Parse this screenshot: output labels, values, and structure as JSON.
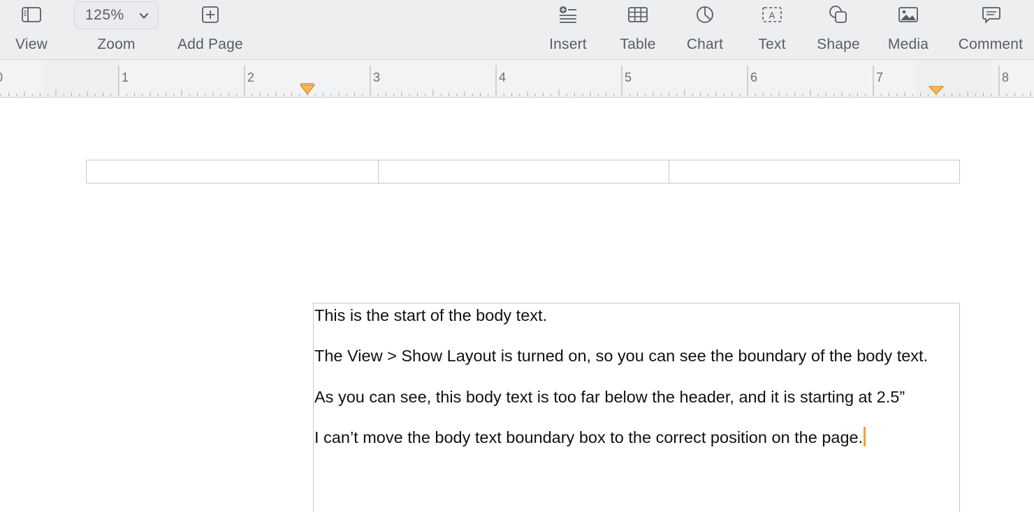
{
  "toolbar": {
    "view_label": "View",
    "zoom_label": "Zoom",
    "zoom_value": "125%",
    "add_page_label": "Add Page",
    "insert_label": "Insert",
    "table_label": "Table",
    "chart_label": "Chart",
    "text_label": "Text",
    "shape_label": "Shape",
    "media_label": "Media",
    "comment_label": "Comment"
  },
  "icons": {
    "view": "sidebar-icon",
    "zoom": "chevron-down-icon",
    "add_page": "plus-square-icon",
    "insert": "insert-list-icon",
    "table": "table-icon",
    "chart": "pie-chart-icon",
    "text": "text-box-icon",
    "shape": "shape-icon",
    "media": "photo-icon",
    "comment": "speech-bubble-icon"
  },
  "ruler": {
    "numbers": [
      "0",
      "1",
      "2",
      "3",
      "4",
      "5",
      "6",
      "7",
      "8"
    ],
    "indent_marker_left": 2.5,
    "indent_marker_right": 7.5,
    "marker_color": "#f0a530"
  },
  "document": {
    "header_columns": 3,
    "paragraphs": [
      "This is the start of the body text.",
      "The View > Show Layout is turned on, so you can see the boundary of the body text.",
      "As you can see, this body text is too far below the header, and it is starting at 2.5”",
      "I can’t move the body text boundary box to the correct position on the page."
    ],
    "cursor_color": "#f3a227"
  }
}
